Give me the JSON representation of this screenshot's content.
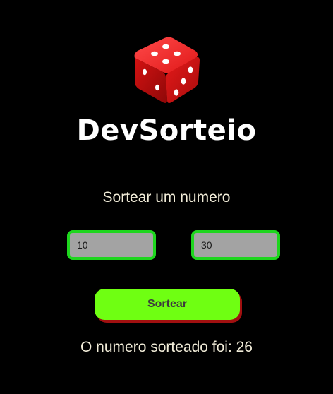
{
  "app": {
    "title": "DevSorteio",
    "logo_icon": "dice-icon"
  },
  "main": {
    "heading": "Sortear um numero",
    "min_input": {
      "value": "10"
    },
    "max_input": {
      "value": "30"
    },
    "draw_button_label": "Sortear",
    "result_label": "O numero sorteado foi:",
    "result_value": "26",
    "result_text": "O numero sorteado foi: 26"
  },
  "colors": {
    "background": "#000000",
    "input_border": "#1ed61e",
    "input_background": "#a3a3a3",
    "button_background": "#6fff12",
    "button_shadow": "#a11010",
    "dice": "#e01818"
  }
}
